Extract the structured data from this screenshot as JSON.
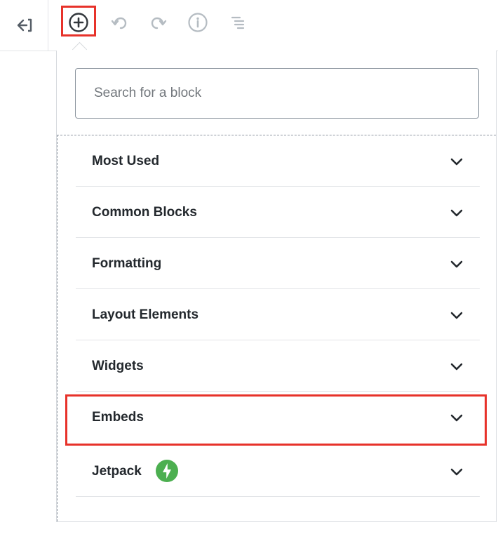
{
  "toolbar": {
    "exit_icon": "exit-arrow-icon",
    "inserter_icon": "plus-circle-icon",
    "undo_icon": "undo-icon",
    "redo_icon": "redo-icon",
    "info_icon": "info-icon",
    "outline_icon": "list-outline-icon"
  },
  "search": {
    "placeholder": "Search for a block"
  },
  "panels": [
    {
      "label": "Most Used"
    },
    {
      "label": "Common Blocks"
    },
    {
      "label": "Formatting"
    },
    {
      "label": "Layout Elements"
    },
    {
      "label": "Widgets"
    },
    {
      "label": "Embeds"
    },
    {
      "label": "Jetpack",
      "icon": "jetpack-icon"
    }
  ],
  "colors": {
    "highlight": "#e7322a",
    "jetpack_green": "#4caf50"
  }
}
